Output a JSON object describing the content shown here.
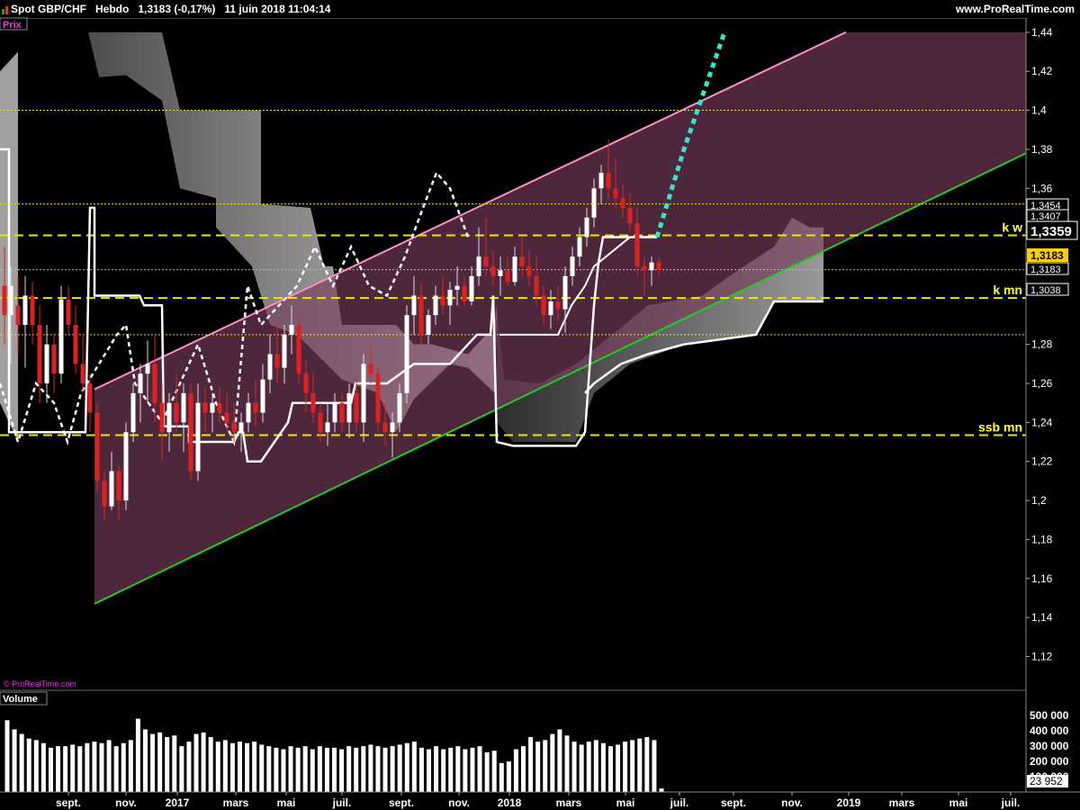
{
  "header": {
    "title": "Spot GBP/CHF   Hebdo   1,3183 (-0,17%)   11 juin 2018 11:04:14",
    "site": "www.ProRealTime.com"
  },
  "panels": {
    "price_label": "Prix",
    "watermark": "© ProRealTime.com",
    "volume_label": "Volume"
  },
  "chart_data": [
    {
      "type": "candlestick",
      "title": "Spot GBP/CHF",
      "timeframe": "Hebdo",
      "last": "1,3183",
      "change": "(-0,17%)",
      "datetime": "11 juin 2018 11:04:14",
      "y_ticks": [
        "1,44",
        "1,42",
        "1,4",
        "1,38",
        "1,36",
        "1,28",
        "1,26",
        "1,24",
        "1,22",
        "1,2",
        "1,18",
        "1,16",
        "1,14",
        "1,12"
      ],
      "ylim": [
        1.105,
        1.445
      ],
      "x_ticks": [
        "sept.",
        "nov.",
        "2017",
        "mars",
        "mai",
        "juil.",
        "sept.",
        "nov.",
        "2018",
        "mars",
        "mai",
        "juil.",
        "sept.",
        "nov.",
        "2019",
        "mars",
        "mai",
        "juil."
      ],
      "price_tags": [
        {
          "value": "1,3454",
          "style": "plain"
        },
        {
          "value": "1,3407",
          "style": "plain"
        },
        {
          "value": "1,3359",
          "style": "boxed-large"
        },
        {
          "value": "1,3183",
          "style": "highlight"
        },
        {
          "value": "1,3183",
          "style": "plain"
        },
        {
          "value": "1,3038",
          "style": "plain"
        }
      ],
      "annotations": [
        {
          "text": "k w",
          "level": 1.3359
        },
        {
          "text": "k mn",
          "level": 1.3038
        },
        {
          "text": "ssb mn",
          "level": 1.2335
        }
      ],
      "horizontal_levels": [
        1.4,
        1.352,
        1.3359,
        1.3183,
        1.3038,
        1.285,
        1.2335
      ],
      "channel": {
        "lower_start": [
          105,
          1.147
        ],
        "lower_end": [
          1140,
          1.378
        ],
        "upper_start": [
          105,
          1.257
        ],
        "upper_end": [
          940,
          1.44
        ]
      },
      "candles": [
        {
          "x": 5,
          "o": 1.31,
          "h": 1.33,
          "l": 1.28,
          "c": 1.295
        },
        {
          "x": 12,
          "o": 1.295,
          "h": 1.32,
          "l": 1.27,
          "c": 1.31
        },
        {
          "x": 20,
          "o": 1.3,
          "h": 1.315,
          "l": 1.275,
          "c": 1.29
        },
        {
          "x": 28,
          "o": 1.29,
          "h": 1.315,
          "l": 1.268,
          "c": 1.305
        },
        {
          "x": 36,
          "o": 1.305,
          "h": 1.312,
          "l": 1.28,
          "c": 1.29
        },
        {
          "x": 44,
          "o": 1.29,
          "h": 1.3,
          "l": 1.25,
          "c": 1.26
        },
        {
          "x": 52,
          "o": 1.26,
          "h": 1.29,
          "l": 1.25,
          "c": 1.28
        },
        {
          "x": 60,
          "o": 1.28,
          "h": 1.285,
          "l": 1.255,
          "c": 1.265
        },
        {
          "x": 68,
          "o": 1.265,
          "h": 1.31,
          "l": 1.26,
          "c": 1.303
        },
        {
          "x": 76,
          "o": 1.303,
          "h": 1.31,
          "l": 1.285,
          "c": 1.29
        },
        {
          "x": 84,
          "o": 1.29,
          "h": 1.3,
          "l": 1.265,
          "c": 1.27
        },
        {
          "x": 92,
          "o": 1.27,
          "h": 1.285,
          "l": 1.255,
          "c": 1.26
        },
        {
          "x": 100,
          "o": 1.26,
          "h": 1.265,
          "l": 1.235,
          "c": 1.245
        },
        {
          "x": 108,
          "o": 1.245,
          "h": 1.25,
          "l": 1.205,
          "c": 1.21
        },
        {
          "x": 116,
          "o": 1.21,
          "h": 1.215,
          "l": 1.19,
          "c": 1.197
        },
        {
          "x": 124,
          "o": 1.197,
          "h": 1.225,
          "l": 1.195,
          "c": 1.215
        },
        {
          "x": 132,
          "o": 1.215,
          "h": 1.218,
          "l": 1.19,
          "c": 1.2
        },
        {
          "x": 140,
          "o": 1.2,
          "h": 1.24,
          "l": 1.195,
          "c": 1.235
        },
        {
          "x": 148,
          "o": 1.235,
          "h": 1.26,
          "l": 1.23,
          "c": 1.255
        },
        {
          "x": 156,
          "o": 1.255,
          "h": 1.27,
          "l": 1.24,
          "c": 1.265
        },
        {
          "x": 164,
          "o": 1.265,
          "h": 1.282,
          "l": 1.25,
          "c": 1.27
        },
        {
          "x": 172,
          "o": 1.27,
          "h": 1.285,
          "l": 1.24,
          "c": 1.25
        },
        {
          "x": 180,
          "o": 1.25,
          "h": 1.26,
          "l": 1.22,
          "c": 1.235
        },
        {
          "x": 188,
          "o": 1.235,
          "h": 1.255,
          "l": 1.225,
          "c": 1.25
        },
        {
          "x": 196,
          "o": 1.25,
          "h": 1.265,
          "l": 1.235,
          "c": 1.24
        },
        {
          "x": 204,
          "o": 1.24,
          "h": 1.26,
          "l": 1.225,
          "c": 1.255
        },
        {
          "x": 212,
          "o": 1.255,
          "h": 1.26,
          "l": 1.21,
          "c": 1.215
        },
        {
          "x": 220,
          "o": 1.215,
          "h": 1.26,
          "l": 1.21,
          "c": 1.25
        },
        {
          "x": 228,
          "o": 1.25,
          "h": 1.258,
          "l": 1.235,
          "c": 1.245
        },
        {
          "x": 236,
          "o": 1.245,
          "h": 1.255,
          "l": 1.235,
          "c": 1.25
        },
        {
          "x": 244,
          "o": 1.25,
          "h": 1.258,
          "l": 1.24,
          "c": 1.245
        },
        {
          "x": 252,
          "o": 1.245,
          "h": 1.255,
          "l": 1.235,
          "c": 1.24
        },
        {
          "x": 260,
          "o": 1.24,
          "h": 1.25,
          "l": 1.23,
          "c": 1.235
        },
        {
          "x": 268,
          "o": 1.235,
          "h": 1.245,
          "l": 1.225,
          "c": 1.24
        },
        {
          "x": 276,
          "o": 1.24,
          "h": 1.255,
          "l": 1.235,
          "c": 1.25
        },
        {
          "x": 284,
          "o": 1.25,
          "h": 1.262,
          "l": 1.238,
          "c": 1.245
        },
        {
          "x": 292,
          "o": 1.245,
          "h": 1.27,
          "l": 1.24,
          "c": 1.262
        },
        {
          "x": 300,
          "o": 1.262,
          "h": 1.285,
          "l": 1.255,
          "c": 1.275
        },
        {
          "x": 308,
          "o": 1.275,
          "h": 1.29,
          "l": 1.26,
          "c": 1.268
        },
        {
          "x": 316,
          "o": 1.268,
          "h": 1.29,
          "l": 1.26,
          "c": 1.285
        },
        {
          "x": 324,
          "o": 1.285,
          "h": 1.3,
          "l": 1.275,
          "c": 1.29
        },
        {
          "x": 332,
          "o": 1.29,
          "h": 1.295,
          "l": 1.26,
          "c": 1.265
        },
        {
          "x": 340,
          "o": 1.265,
          "h": 1.272,
          "l": 1.245,
          "c": 1.255
        },
        {
          "x": 348,
          "o": 1.255,
          "h": 1.265,
          "l": 1.24,
          "c": 1.245
        },
        {
          "x": 356,
          "o": 1.245,
          "h": 1.25,
          "l": 1.23,
          "c": 1.235
        },
        {
          "x": 364,
          "o": 1.235,
          "h": 1.25,
          "l": 1.228,
          "c": 1.24
        },
        {
          "x": 372,
          "o": 1.24,
          "h": 1.255,
          "l": 1.235,
          "c": 1.25
        },
        {
          "x": 380,
          "o": 1.25,
          "h": 1.255,
          "l": 1.235,
          "c": 1.24
        },
        {
          "x": 388,
          "o": 1.24,
          "h": 1.26,
          "l": 1.232,
          "c": 1.255
        },
        {
          "x": 396,
          "o": 1.255,
          "h": 1.262,
          "l": 1.235,
          "c": 1.24
        },
        {
          "x": 404,
          "o": 1.24,
          "h": 1.275,
          "l": 1.23,
          "c": 1.27
        },
        {
          "x": 412,
          "o": 1.27,
          "h": 1.28,
          "l": 1.26,
          "c": 1.265
        },
        {
          "x": 420,
          "o": 1.265,
          "h": 1.268,
          "l": 1.235,
          "c": 1.24
        },
        {
          "x": 428,
          "o": 1.24,
          "h": 1.25,
          "l": 1.228,
          "c": 1.235
        },
        {
          "x": 436,
          "o": 1.235,
          "h": 1.245,
          "l": 1.222,
          "c": 1.24
        },
        {
          "x": 444,
          "o": 1.24,
          "h": 1.26,
          "l": 1.235,
          "c": 1.255
        },
        {
          "x": 452,
          "o": 1.255,
          "h": 1.3,
          "l": 1.25,
          "c": 1.295
        },
        {
          "x": 460,
          "o": 1.295,
          "h": 1.315,
          "l": 1.285,
          "c": 1.305
        },
        {
          "x": 468,
          "o": 1.305,
          "h": 1.312,
          "l": 1.28,
          "c": 1.285
        },
        {
          "x": 476,
          "o": 1.285,
          "h": 1.298,
          "l": 1.28,
          "c": 1.295
        },
        {
          "x": 484,
          "o": 1.295,
          "h": 1.31,
          "l": 1.29,
          "c": 1.305
        },
        {
          "x": 492,
          "o": 1.305,
          "h": 1.315,
          "l": 1.295,
          "c": 1.3
        },
        {
          "x": 500,
          "o": 1.3,
          "h": 1.312,
          "l": 1.29,
          "c": 1.308
        },
        {
          "x": 508,
          "o": 1.308,
          "h": 1.32,
          "l": 1.3,
          "c": 1.31
        },
        {
          "x": 516,
          "o": 1.31,
          "h": 1.315,
          "l": 1.3,
          "c": 1.302
        },
        {
          "x": 524,
          "o": 1.302,
          "h": 1.32,
          "l": 1.3,
          "c": 1.315
        },
        {
          "x": 532,
          "o": 1.315,
          "h": 1.34,
          "l": 1.31,
          "c": 1.325
        },
        {
          "x": 540,
          "o": 1.325,
          "h": 1.345,
          "l": 1.315,
          "c": 1.32
        },
        {
          "x": 548,
          "o": 1.32,
          "h": 1.328,
          "l": 1.31,
          "c": 1.315
        },
        {
          "x": 556,
          "o": 1.315,
          "h": 1.325,
          "l": 1.305,
          "c": 1.318
        },
        {
          "x": 564,
          "o": 1.318,
          "h": 1.325,
          "l": 1.31,
          "c": 1.312
        },
        {
          "x": 572,
          "o": 1.312,
          "h": 1.33,
          "l": 1.31,
          "c": 1.325
        },
        {
          "x": 580,
          "o": 1.325,
          "h": 1.335,
          "l": 1.315,
          "c": 1.32
        },
        {
          "x": 588,
          "o": 1.32,
          "h": 1.328,
          "l": 1.31,
          "c": 1.315
        },
        {
          "x": 596,
          "o": 1.315,
          "h": 1.325,
          "l": 1.3,
          "c": 1.305
        },
        {
          "x": 604,
          "o": 1.305,
          "h": 1.31,
          "l": 1.29,
          "c": 1.295
        },
        {
          "x": 612,
          "o": 1.295,
          "h": 1.308,
          "l": 1.288,
          "c": 1.302
        },
        {
          "x": 620,
          "o": 1.302,
          "h": 1.31,
          "l": 1.292,
          "c": 1.298
        },
        {
          "x": 628,
          "o": 1.298,
          "h": 1.32,
          "l": 1.286,
          "c": 1.315
        },
        {
          "x": 636,
          "o": 1.315,
          "h": 1.33,
          "l": 1.31,
          "c": 1.325
        },
        {
          "x": 644,
          "o": 1.325,
          "h": 1.34,
          "l": 1.32,
          "c": 1.335
        },
        {
          "x": 652,
          "o": 1.335,
          "h": 1.35,
          "l": 1.33,
          "c": 1.345
        },
        {
          "x": 660,
          "o": 1.345,
          "h": 1.365,
          "l": 1.34,
          "c": 1.36
        },
        {
          "x": 668,
          "o": 1.36,
          "h": 1.372,
          "l": 1.352,
          "c": 1.368
        },
        {
          "x": 676,
          "o": 1.368,
          "h": 1.385,
          "l": 1.355,
          "c": 1.36
        },
        {
          "x": 684,
          "o": 1.36,
          "h": 1.375,
          "l": 1.35,
          "c": 1.355
        },
        {
          "x": 692,
          "o": 1.355,
          "h": 1.362,
          "l": 1.345,
          "c": 1.35
        },
        {
          "x": 700,
          "o": 1.35,
          "h": 1.358,
          "l": 1.338,
          "c": 1.342
        },
        {
          "x": 708,
          "o": 1.342,
          "h": 1.35,
          "l": 1.315,
          "c": 1.32
        },
        {
          "x": 716,
          "o": 1.32,
          "h": 1.325,
          "l": 1.305,
          "c": 1.318
        },
        {
          "x": 724,
          "o": 1.318,
          "h": 1.325,
          "l": 1.31,
          "c": 1.322
        },
        {
          "x": 732,
          "o": 1.322,
          "h": 1.325,
          "l": 1.315,
          "c": 1.3183
        }
      ]
    },
    {
      "type": "bar",
      "title": "Volume",
      "y_ticks": [
        "500 000",
        "400 000",
        "300 000",
        "200 000",
        "100 000"
      ],
      "ylim": [
        0,
        560000
      ],
      "last_value": "23 952",
      "values": [
        470000,
        410000,
        380000,
        350000,
        340000,
        320000,
        290000,
        300000,
        300000,
        310000,
        300000,
        320000,
        330000,
        320000,
        340000,
        300000,
        320000,
        340000,
        480000,
        410000,
        380000,
        390000,
        360000,
        370000,
        300000,
        330000,
        380000,
        390000,
        360000,
        330000,
        340000,
        320000,
        330000,
        320000,
        330000,
        310000,
        300000,
        290000,
        280000,
        300000,
        290000,
        300000,
        280000,
        300000,
        290000,
        290000,
        280000,
        300000,
        290000,
        300000,
        310000,
        300000,
        290000,
        300000,
        310000,
        320000,
        330000,
        290000,
        280000,
        300000,
        280000,
        290000,
        300000,
        280000,
        290000,
        300000,
        260000,
        270000,
        190000,
        200000,
        280000,
        300000,
        360000,
        330000,
        340000,
        380000,
        410000,
        370000,
        330000,
        310000,
        330000,
        340000,
        320000,
        300000,
        310000,
        330000,
        340000,
        350000,
        360000,
        340000,
        23952
      ]
    }
  ]
}
